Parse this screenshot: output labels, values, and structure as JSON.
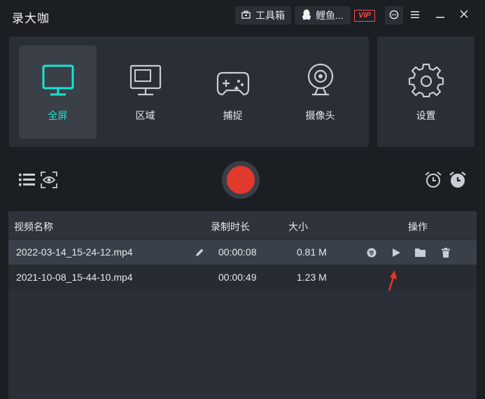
{
  "app": {
    "title": "录大咖"
  },
  "header": {
    "toolbox_label": "工具箱",
    "user_name": "鲤鱼...",
    "vip_label": "VIP"
  },
  "modes": [
    {
      "label": "全屏",
      "icon": "monitor-icon",
      "active": true
    },
    {
      "label": "区域",
      "icon": "region-icon",
      "active": false
    },
    {
      "label": "捕捉",
      "icon": "gamepad-icon",
      "active": false
    },
    {
      "label": "摄像头",
      "icon": "webcam-icon",
      "active": false
    }
  ],
  "settings": {
    "label": "设置",
    "icon": "gear-icon"
  },
  "colors": {
    "accent": "#19e3d4",
    "record": "#e03a2c",
    "vip": "#ff4c4c",
    "arrow": "#e8352b"
  },
  "table": {
    "headers": {
      "name": "视频名称",
      "duration": "录制时长",
      "size": "大小",
      "actions": "操作"
    },
    "rows": [
      {
        "name": "2022-03-14_15-24-12.mp4",
        "duration": "00:00:08",
        "size": "0.81 M",
        "selected": true
      },
      {
        "name": "2021-10-08_15-44-10.mp4",
        "duration": "00:00:49",
        "size": "1.23 M",
        "selected": false
      }
    ]
  }
}
